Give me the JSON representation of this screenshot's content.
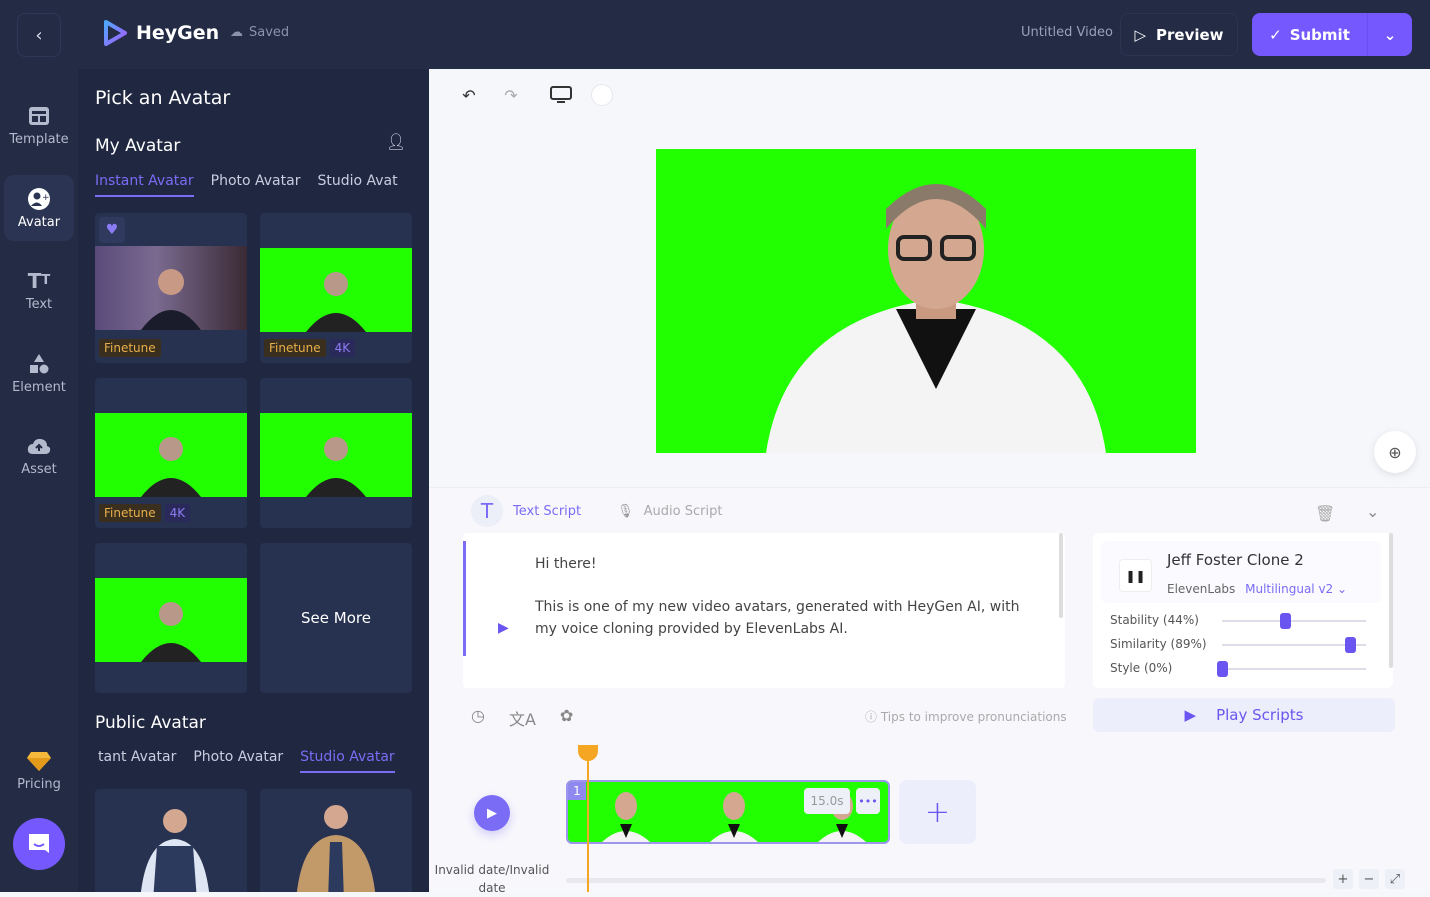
{
  "app": {
    "name": "HeyGen",
    "saved_label": "Saved",
    "video_title": "Untitled Video"
  },
  "header": {
    "preview_label": "Preview",
    "submit_label": "Submit"
  },
  "nav": {
    "items": [
      {
        "label": "Template",
        "icon": "template-icon"
      },
      {
        "label": "Avatar",
        "icon": "avatar-icon",
        "active": true
      },
      {
        "label": "Text",
        "icon": "text-icon"
      },
      {
        "label": "Element",
        "icon": "element-icon"
      },
      {
        "label": "Asset",
        "icon": "asset-icon"
      }
    ],
    "pricing_label": "Pricing"
  },
  "panel": {
    "title": "Pick an Avatar",
    "my_avatar": {
      "heading": "My Avatar",
      "tabs": [
        "Instant Avatar",
        "Photo Avatar",
        "Studio Avat"
      ],
      "active_tab": 0,
      "cards": [
        {
          "badges": [
            "Finetune"
          ],
          "favorite": true,
          "bg": "room"
        },
        {
          "badges": [
            "Finetune",
            "4K"
          ],
          "bg": "green"
        },
        {
          "badges": [
            "Finetune",
            "4K"
          ],
          "bg": "green"
        },
        {
          "badges": [],
          "bg": "green"
        },
        {
          "badges": [],
          "bg": "green"
        }
      ],
      "see_more_label": "See More"
    },
    "public_avatar": {
      "heading": "Public Avatar",
      "tabs": [
        "tant Avatar",
        "Photo Avatar",
        "Studio Avatar"
      ],
      "active_tab": 2
    }
  },
  "canvas": {
    "zoom_icon": "zoom-in-icon"
  },
  "script": {
    "tabs": {
      "text": "Text Script",
      "audio": "Audio Script"
    },
    "line1": "Hi there!",
    "line2": "This is one of my new video avatars, generated with HeyGen AI, with my voice cloning provided by ElevenLabs AI.",
    "tips": "Tips to improve pronunciations"
  },
  "voice": {
    "name": "Jeff Foster Clone 2",
    "provider": "ElevenLabs",
    "model": "Multilingual v2",
    "sliders": [
      {
        "label": "Stability (44%)",
        "value": 0.44
      },
      {
        "label": "Similarity (89%)",
        "value": 0.89
      },
      {
        "label": "Style (0%)",
        "value": 0.0
      }
    ],
    "play_scripts_label": "Play Scripts"
  },
  "timeline": {
    "date_label": "Invalid date/Invalid date",
    "scene_number": "1",
    "scene_duration": "15.0s",
    "playhead_fraction": 0.07
  }
}
